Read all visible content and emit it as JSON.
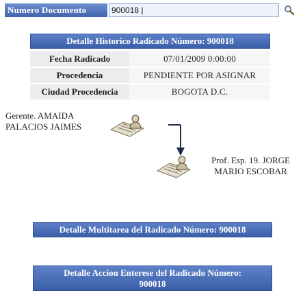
{
  "search": {
    "label": "Numero Documento",
    "value": "900018 |"
  },
  "history": {
    "header": "Detalle Historico Radicado Número: 900018",
    "rows": [
      {
        "label": "Fecha Radicado",
        "value": "07/01/2009 0:00:00"
      },
      {
        "label": "Procedencia",
        "value": "PENDIENTE POR ASIGNAR"
      },
      {
        "label": "Ciudad Procedencia",
        "value": "BOGOTA D.C."
      }
    ]
  },
  "flow": {
    "sender": {
      "line1": "Gerente. AMAIDA",
      "line2": "PALACIOS JAIMES"
    },
    "receiver": {
      "line1": "Prof. Esp. 19. JORGE",
      "line2": "MARIO ESCOBAR"
    }
  },
  "buttons": {
    "multitask": "Detalle Multitarea del Radicado Número: 900018",
    "action_line1": "Detalle Accion Enterese del Radicado Número:",
    "action_line2": "900018"
  },
  "icons": {
    "search": "magnifier-icon",
    "user_doc": "user-document-icon",
    "arrow": "down-arrow-icon"
  },
  "colors": {
    "header_blue": "#3f63ad",
    "input_bg": "#eef3fb"
  }
}
